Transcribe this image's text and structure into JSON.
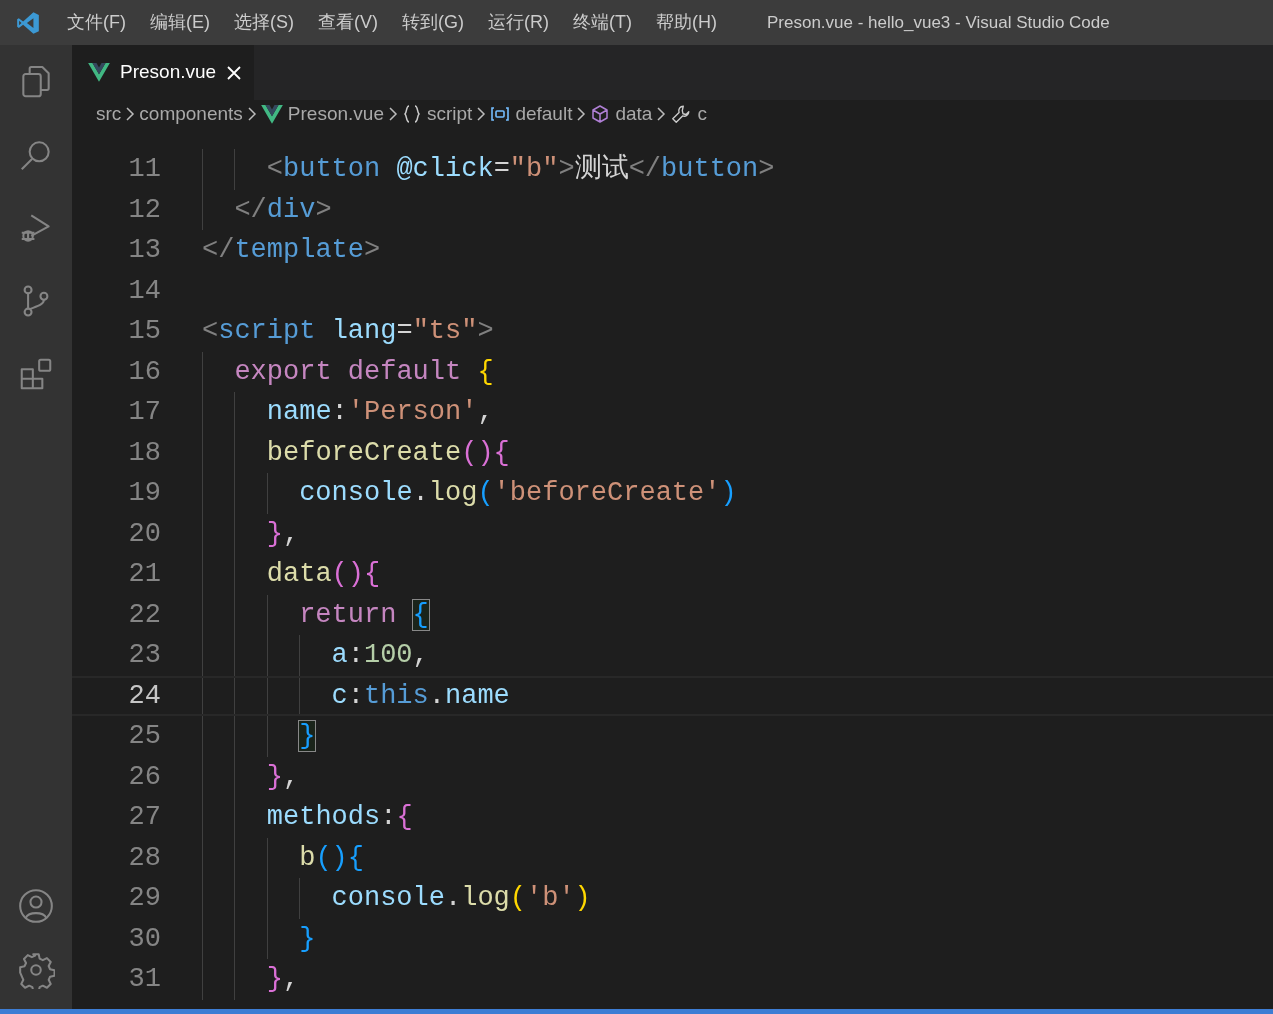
{
  "window": {
    "title": "Preson.vue - hello_vue3 - Visual Studio Code"
  },
  "menu": [
    "文件(F)",
    "编辑(E)",
    "选择(S)",
    "查看(V)",
    "转到(G)",
    "运行(R)",
    "终端(T)",
    "帮助(H)"
  ],
  "activity_bar": [
    {
      "kind": "files",
      "selected": false
    },
    {
      "kind": "search",
      "selected": false
    },
    {
      "kind": "debug",
      "selected": false
    },
    {
      "kind": "git",
      "selected": false
    },
    {
      "kind": "extensions",
      "selected": false
    }
  ],
  "activity_bar_bottom": [
    {
      "kind": "account"
    },
    {
      "kind": "settings"
    }
  ],
  "tabs": [
    {
      "label": "Preson.vue",
      "selected": true
    }
  ],
  "breadcrumb": [
    {
      "kind": "folder",
      "label": "src"
    },
    {
      "kind": "folder",
      "label": "components"
    },
    {
      "kind": "vue",
      "label": "Preson.vue"
    },
    {
      "kind": "braces",
      "label": "script"
    },
    {
      "kind": "module",
      "label": "default"
    },
    {
      "kind": "object",
      "label": "data"
    },
    {
      "kind": "field",
      "label": "c"
    }
  ],
  "editor": {
    "lines": [
      {
        "children": [
          {
            "children": [
              {
                "number": "11",
                "current": false,
                "tokens": [
                  {
                    "text": "<",
                    "kind": "punct"
                  },
                  {
                    "text": "button ",
                    "kind": "tag"
                  },
                  {
                    "text": "@click",
                    "kind": "attr"
                  },
                  {
                    "text": "=",
                    "kind": "plain"
                  },
                  {
                    "text": "\"b\"",
                    "kind": "str"
                  },
                  {
                    "text": ">",
                    "kind": "punct"
                  },
                  {
                    "text": "测试",
                    "kind": "plain"
                  },
                  {
                    "text": "</",
                    "kind": "punct"
                  },
                  {
                    "text": "button",
                    "kind": "tag"
                  },
                  {
                    "text": ">",
                    "kind": "punct"
                  }
                ]
              }
            ]
          },
          {
            "number": "12",
            "current": false,
            "tokens": [
              {
                "text": "</",
                "kind": "punct"
              },
              {
                "text": "div",
                "kind": "tag"
              },
              {
                "text": ">",
                "kind": "punct"
              }
            ]
          }
        ]
      },
      {
        "number": "13",
        "current": false,
        "tokens": [
          {
            "text": "</",
            "kind": "punct"
          },
          {
            "text": "template",
            "kind": "tag"
          },
          {
            "text": ">",
            "kind": "punct"
          }
        ]
      },
      {
        "number": "14",
        "current": false
      },
      {
        "number": "15",
        "current": false,
        "tokens": [
          {
            "text": "<",
            "kind": "punct"
          },
          {
            "text": "script ",
            "kind": "tag"
          },
          {
            "text": "lang",
            "kind": "attr"
          },
          {
            "text": "=",
            "kind": "plain"
          },
          {
            "text": "\"ts\"",
            "kind": "str"
          },
          {
            "text": ">",
            "kind": "punct"
          }
        ],
        "children": [
          {
            "number": "16",
            "current": false,
            "tokens": [
              {
                "text": "export default ",
                "kind": "keyword"
              },
              {
                "text": "{",
                "kind": "bracket1"
              }
            ],
            "children": [
              {
                "number": "17",
                "current": false,
                "tokens": [
                  {
                    "text": "name",
                    "kind": "prop"
                  },
                  {
                    "text": ":",
                    "kind": "plain"
                  },
                  {
                    "text": "'Person'",
                    "kind": "str"
                  },
                  {
                    "text": ",",
                    "kind": "plain"
                  }
                ]
              },
              {
                "number": "18",
                "current": false,
                "tokens": [
                  {
                    "text": "beforeCreate",
                    "kind": "function"
                  },
                  {
                    "text": "(){",
                    "kind": "bracket2"
                  }
                ],
                "children": [
                  {
                    "number": "19",
                    "current": false,
                    "tokens": [
                      {
                        "text": "console",
                        "kind": "prop"
                      },
                      {
                        "text": ".",
                        "kind": "plain"
                      },
                      {
                        "text": "log",
                        "kind": "function"
                      },
                      {
                        "text": "(",
                        "kind": "bracket3"
                      },
                      {
                        "text": "'beforeCreate'",
                        "kind": "str"
                      },
                      {
                        "text": ")",
                        "kind": "bracket3"
                      }
                    ]
                  }
                ]
              },
              {
                "number": "20",
                "current": false,
                "tokens": [
                  {
                    "text": "}",
                    "kind": "bracket2"
                  },
                  {
                    "text": ",",
                    "kind": "plain"
                  }
                ]
              },
              {
                "number": "21",
                "current": false,
                "tokens": [
                  {
                    "text": "data",
                    "kind": "function"
                  },
                  {
                    "text": "(){",
                    "kind": "bracket2"
                  }
                ],
                "children": [
                  {
                    "number": "22",
                    "current": false,
                    "tokens": [
                      {
                        "text": "return ",
                        "kind": "keyword"
                      },
                      {
                        "text": "{",
                        "kind": "matched"
                      }
                    ],
                    "children": [
                      {
                        "number": "23",
                        "current": false,
                        "tokens": [
                          {
                            "text": "a",
                            "kind": "prop"
                          },
                          {
                            "text": ":",
                            "kind": "plain"
                          },
                          {
                            "text": "100",
                            "kind": "number"
                          },
                          {
                            "text": ",",
                            "kind": "plain"
                          }
                        ]
                      },
                      {
                        "number": "24",
                        "current": true,
                        "tokens": [
                          {
                            "text": "c",
                            "kind": "prop"
                          },
                          {
                            "text": ":",
                            "kind": "plain"
                          },
                          {
                            "text": "this",
                            "kind": "self"
                          },
                          {
                            "text": ".",
                            "kind": "plain"
                          },
                          {
                            "text": "name",
                            "kind": "prop"
                          }
                        ]
                      }
                    ]
                  },
                  {
                    "number": "25",
                    "current": false,
                    "tokens": [
                      {
                        "text": "}",
                        "kind": "matched"
                      }
                    ]
                  }
                ]
              },
              {
                "number": "26",
                "current": false,
                "tokens": [
                  {
                    "text": "}",
                    "kind": "bracket2"
                  },
                  {
                    "text": ",",
                    "kind": "plain"
                  }
                ]
              },
              {
                "number": "27",
                "current": false,
                "tokens": [
                  {
                    "text": "methods",
                    "kind": "prop"
                  },
                  {
                    "text": ":",
                    "kind": "plain"
                  },
                  {
                    "text": "{",
                    "kind": "bracket2"
                  }
                ],
                "children": [
                  {
                    "number": "28",
                    "current": false,
                    "tokens": [
                      {
                        "text": "b",
                        "kind": "function"
                      },
                      {
                        "text": "(){",
                        "kind": "bracket3"
                      }
                    ],
                    "children": [
                      {
                        "number": "29",
                        "current": false,
                        "tokens": [
                          {
                            "text": "console",
                            "kind": "prop"
                          },
                          {
                            "text": ".",
                            "kind": "plain"
                          },
                          {
                            "text": "log",
                            "kind": "function"
                          },
                          {
                            "text": "(",
                            "kind": "bracket1"
                          },
                          {
                            "text": "'b'",
                            "kind": "str"
                          },
                          {
                            "text": ")",
                            "kind": "bracket1"
                          }
                        ]
                      }
                    ]
                  },
                  {
                    "number": "30",
                    "current": false,
                    "tokens": [
                      {
                        "text": "}",
                        "kind": "bracket3"
                      }
                    ]
                  }
                ]
              },
              {
                "number": "31",
                "current": false,
                "tokens": [
                  {
                    "text": "}",
                    "kind": "bracket2"
                  },
                  {
                    "text": ",",
                    "kind": "plain"
                  }
                ]
              }
            ]
          }
        ]
      }
    ]
  }
}
